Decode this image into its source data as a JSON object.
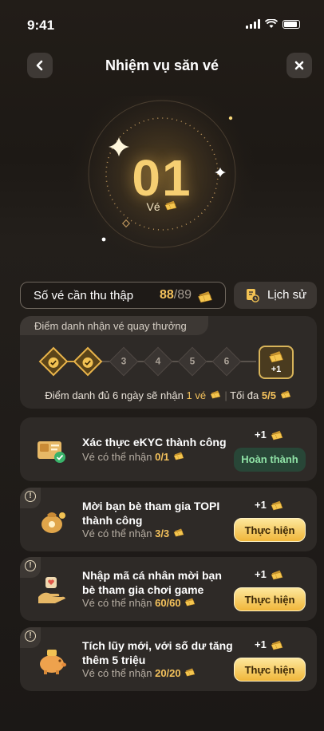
{
  "status_bar": {
    "time": "9:41"
  },
  "header": {
    "title": "Nhiệm vụ săn vé"
  },
  "hero": {
    "count": "01",
    "unit": "Vé"
  },
  "collection": {
    "label": "Số vé cần thu thập",
    "current": "88",
    "total": "/89"
  },
  "history": {
    "label": "Lịch sử"
  },
  "checkin": {
    "title": "Điểm danh nhận vé quay thưởng",
    "days": [
      {
        "label": "1",
        "done": true
      },
      {
        "label": "2",
        "done": true
      },
      {
        "label": "3",
        "done": false
      },
      {
        "label": "4",
        "done": false
      },
      {
        "label": "5",
        "done": false
      },
      {
        "label": "6",
        "done": false
      }
    ],
    "bonus": "+1",
    "footer_prefix": "Điểm danh đủ 6 ngày sẽ nhận",
    "footer_highlight": "1 vé",
    "footer_sep": "|",
    "footer_max_label": "Tối đa",
    "footer_max_value": "5/5"
  },
  "tasks": [
    {
      "name": "Xác thực eKYC thành công",
      "sub_label": "Vé có thể nhận",
      "sub_value": "0/1",
      "reward": "+1",
      "button": "Hoàn thành",
      "icon": "id-card-icon"
    },
    {
      "name": "Mời bạn bè tham gia TOPI thành công",
      "sub_label": "Vé có thể nhận",
      "sub_value": "3/3",
      "reward": "+1",
      "button": "Thực hiện",
      "icon": "money-bag-icon"
    },
    {
      "name": "Nhập mã cá nhân mời bạn bè tham gia chơi game",
      "sub_label": "Vé có thể nhận",
      "sub_value": "60/60",
      "reward": "+1",
      "button": "Thực hiện",
      "icon": "hand-heart-icon"
    },
    {
      "name": "Tích lũy mới, với số dư tăng thêm 5 triệu",
      "sub_label": "Vé có thể nhận",
      "sub_value": "20/20",
      "reward": "+1",
      "button": "Thực hiện",
      "icon": "piggy-bank-icon"
    }
  ],
  "colors": {
    "accent_gold": "#f4c25c",
    "success_green": "#8fe2a6",
    "background": "#1b1816"
  }
}
